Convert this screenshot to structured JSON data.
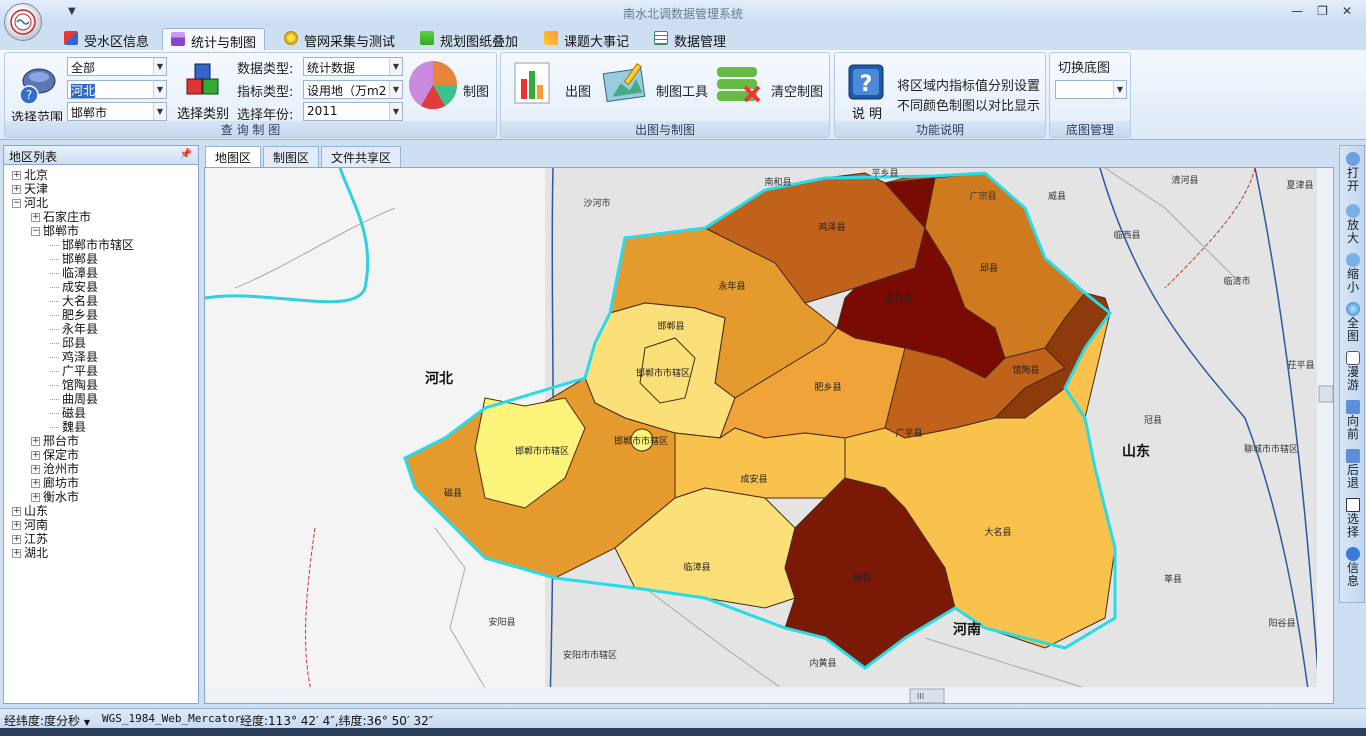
{
  "app": {
    "title": "南水北调数据管理系统",
    "logo_text": "LOGO"
  },
  "tabs": [
    {
      "label": "受水区信息",
      "icon": "grid-color-icon"
    },
    {
      "label": "统计与制图",
      "icon": "chart-icon"
    },
    {
      "label": "管网采集与测试",
      "icon": "gear-icon"
    },
    {
      "label": "规划图纸叠加",
      "icon": "plus-layers-icon"
    },
    {
      "label": "课题大事记",
      "icon": "pen-icon"
    },
    {
      "label": "数据管理",
      "icon": "table-icon"
    }
  ],
  "ribbon": {
    "query": {
      "range_label": "选择范围",
      "combo1": "全部",
      "combo2": "河北",
      "combo3": "邯郸市",
      "category_label": "选择类别",
      "data_type_label": "数据类型:",
      "data_type_value": "统计数据",
      "index_type_label": "指标类型:",
      "index_type_value": "设用地（万m2",
      "year_label": "选择年份:",
      "year_value": "2011",
      "draw_label": "制图",
      "group_label": "查 询 制 图"
    },
    "output": {
      "print_label": "出图",
      "tools_label": "制图工具",
      "clear_label": "清空制图",
      "group_label": "出图与制图"
    },
    "help": {
      "label": "说 明",
      "line1": "将区域内指标值分别设置",
      "line2": "不同颜色制图以对比显示",
      "group_label": "功能说明"
    },
    "base": {
      "switch_label": "切换底图",
      "combo": "",
      "group_label": "底图管理"
    }
  },
  "sidebar": {
    "title": "地区列表",
    "nodes": [
      {
        "label": "北京",
        "level": 0,
        "toggle": "+"
      },
      {
        "label": "天津",
        "level": 0,
        "toggle": "+"
      },
      {
        "label": "河北",
        "level": 0,
        "toggle": "-"
      },
      {
        "label": "石家庄市",
        "level": 1,
        "toggle": "+"
      },
      {
        "label": "邯郸市",
        "level": 1,
        "toggle": "-"
      },
      {
        "label": "邯郸市市辖区",
        "level": 2,
        "toggle": ""
      },
      {
        "label": "邯郸县",
        "level": 2,
        "toggle": ""
      },
      {
        "label": "临漳县",
        "level": 2,
        "toggle": ""
      },
      {
        "label": "成安县",
        "level": 2,
        "toggle": ""
      },
      {
        "label": "大名县",
        "level": 2,
        "toggle": ""
      },
      {
        "label": "肥乡县",
        "level": 2,
        "toggle": ""
      },
      {
        "label": "永年县",
        "level": 2,
        "toggle": ""
      },
      {
        "label": "邱县",
        "level": 2,
        "toggle": ""
      },
      {
        "label": "鸡泽县",
        "level": 2,
        "toggle": ""
      },
      {
        "label": "广平县",
        "level": 2,
        "toggle": ""
      },
      {
        "label": "馆陶县",
        "level": 2,
        "toggle": ""
      },
      {
        "label": "曲周县",
        "level": 2,
        "toggle": ""
      },
      {
        "label": "磁县",
        "level": 2,
        "toggle": ""
      },
      {
        "label": "魏县",
        "level": 2,
        "toggle": ""
      },
      {
        "label": "邢台市",
        "level": 1,
        "toggle": "+"
      },
      {
        "label": "保定市",
        "level": 1,
        "toggle": "+"
      },
      {
        "label": "沧州市",
        "level": 1,
        "toggle": "+"
      },
      {
        "label": "廊坊市",
        "level": 1,
        "toggle": "+"
      },
      {
        "label": "衡水市",
        "level": 1,
        "toggle": "+"
      },
      {
        "label": "山东",
        "level": 0,
        "toggle": "+"
      },
      {
        "label": "河南",
        "level": 0,
        "toggle": "+"
      },
      {
        "label": "江苏",
        "level": 0,
        "toggle": "+"
      },
      {
        "label": "湖北",
        "level": 0,
        "toggle": "+"
      }
    ]
  },
  "map_tabs": [
    "地图区",
    "制图区",
    "文件共享区"
  ],
  "map": {
    "province_labels": [
      "河北",
      "山东",
      "河南"
    ],
    "districts": [
      {
        "name": "鸡泽县",
        "color": "#c0621c"
      },
      {
        "name": "曲周县",
        "color": "#7a0a04"
      },
      {
        "name": "邱县",
        "color": "#d07a20"
      },
      {
        "name": "永年县",
        "color": "#e59a2e"
      },
      {
        "name": "邯郸县",
        "color": "#fbe07a"
      },
      {
        "name": "邯郸市市辖区",
        "color": "#fbe07a"
      },
      {
        "name": "肥乡县",
        "color": "#f0a338"
      },
      {
        "name": "广平县",
        "color": "#c0621c"
      },
      {
        "name": "馆陶县",
        "color": "#8e3a0c"
      },
      {
        "name": "磁县",
        "color": "#e59a2e"
      },
      {
        "name": "成安县",
        "color": "#f8c24c"
      },
      {
        "name": "临漳县",
        "color": "#fbe07a"
      },
      {
        "name": "魏县",
        "color": "#7a1a06"
      },
      {
        "name": "大名县",
        "color": "#f8c24c"
      }
    ],
    "context_labels": [
      "沙河市",
      "南和县",
      "平乡县",
      "广宗县",
      "威县",
      "清河县",
      "夏津县",
      "临西县",
      "临清市",
      "茌平县",
      "冠县",
      "聊城市市辖区",
      "莘县",
      "阳谷县",
      "安阳县",
      "安阳市市辖区",
      "内黄县"
    ]
  },
  "right_toolbar": [
    {
      "label": "打开",
      "icon": "open-icon"
    },
    {
      "label": "放大",
      "icon": "zoom-in-icon"
    },
    {
      "label": "缩小",
      "icon": "zoom-out-icon"
    },
    {
      "label": "全图",
      "icon": "globe-icon"
    },
    {
      "label": "漫游",
      "icon": "hand-icon"
    },
    {
      "label": "向前",
      "icon": "arrow-left-icon"
    },
    {
      "label": "后退",
      "icon": "arrow-right-icon"
    },
    {
      "label": "选择",
      "icon": "cursor-icon"
    },
    {
      "label": "信息",
      "icon": "info-icon"
    }
  ],
  "status": {
    "format": "经纬度:度分秒",
    "projection": "WGS_1984_Web_Mercator",
    "coords": "经度:113° 42′ 4″,纬度:36° 50′ 32″"
  }
}
